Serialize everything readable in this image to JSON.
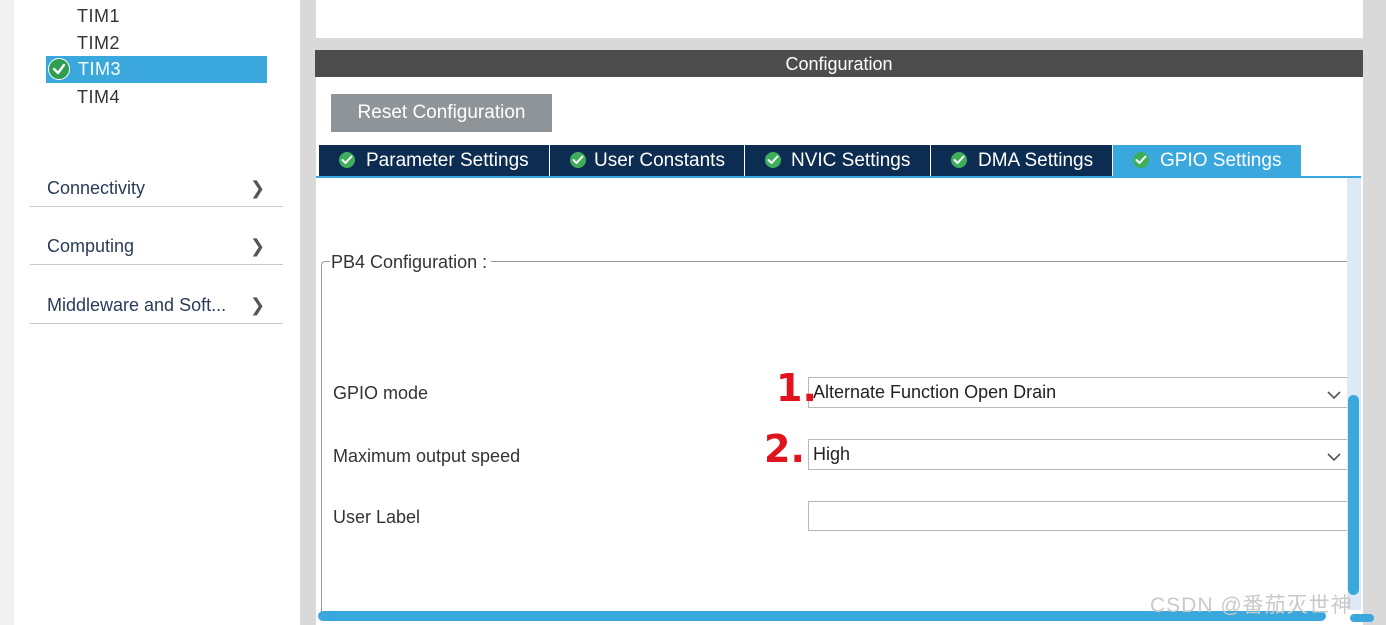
{
  "sidebar": {
    "timers": [
      {
        "label": "TIM1"
      },
      {
        "label": "TIM2"
      },
      {
        "label": "TIM3",
        "selected": true
      },
      {
        "label": "TIM4"
      }
    ],
    "categories": [
      {
        "label": "Connectivity"
      },
      {
        "label": "Computing"
      },
      {
        "label": "Middleware and Soft..."
      }
    ]
  },
  "config": {
    "header": "Configuration",
    "reset_label": "Reset Configuration",
    "tabs": [
      {
        "label": "Parameter Settings"
      },
      {
        "label": "User Constants"
      },
      {
        "label": "NVIC Settings"
      },
      {
        "label": "DMA Settings"
      },
      {
        "label": "GPIO Settings",
        "active": true
      }
    ],
    "group_title": "PB4 Configuration :",
    "fields": {
      "gpio_mode": {
        "label": "GPIO mode",
        "value": "Alternate Function Open Drain"
      },
      "max_speed": {
        "label": "Maximum output speed",
        "value": "High"
      },
      "user_label": {
        "label": "User Label",
        "value": ""
      }
    }
  },
  "annotations": {
    "first": "1.",
    "second": "2."
  },
  "watermark": "CSDN @番茄灭世神",
  "colors": {
    "accent": "#3aa8dd",
    "tab_dark": "#0c2c52",
    "header": "#4d4d4d",
    "check": "#3fae5a"
  }
}
